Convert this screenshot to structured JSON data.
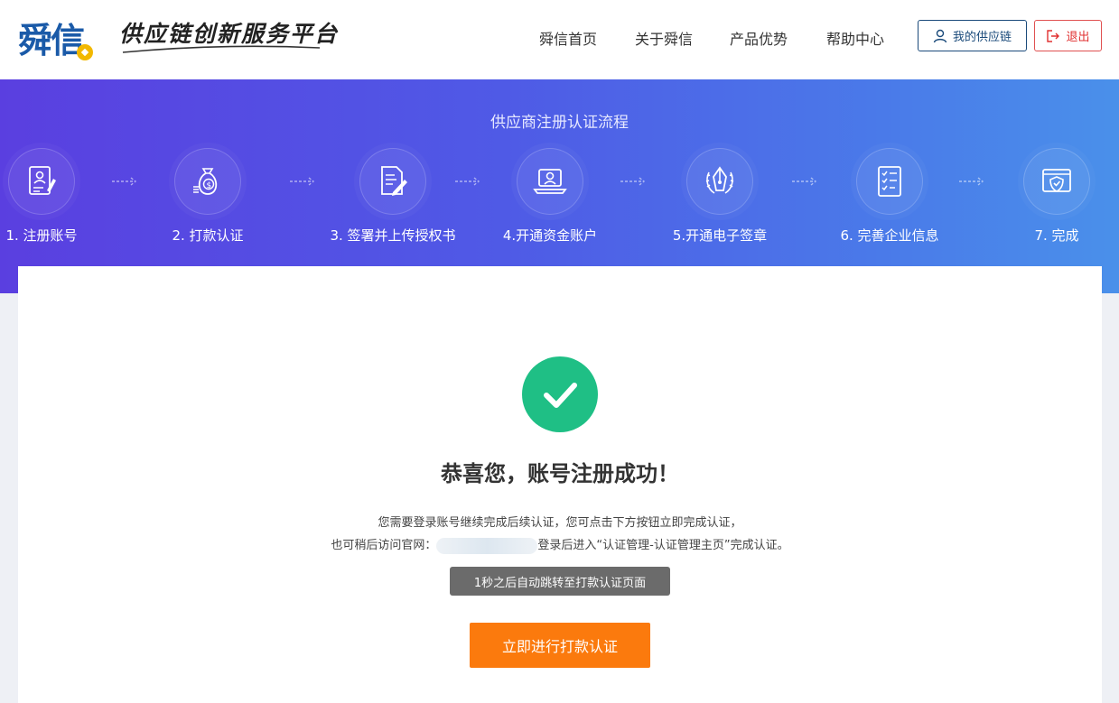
{
  "header": {
    "logo_text": "舜信",
    "slogan": "供应链创新服务平台",
    "nav": [
      {
        "label": "舜信首页"
      },
      {
        "label": "关于舜信"
      },
      {
        "label": "产品优势"
      },
      {
        "label": "帮助中心"
      }
    ],
    "my_chain_label": "我的供应链",
    "exit_label": "退出"
  },
  "banner": {
    "title": "供应商注册认证流程",
    "steps": [
      {
        "label": "1. 注册账号",
        "icon": "register-document-icon"
      },
      {
        "label": "2. 打款认证",
        "icon": "money-bag-icon"
      },
      {
        "label": "3. 签署并上传授权书",
        "icon": "sign-document-icon"
      },
      {
        "label": "4.开通资金账户",
        "icon": "laptop-account-icon"
      },
      {
        "label": "5.开通电子签章",
        "icon": "pen-seal-icon"
      },
      {
        "label": "6. 完善企业信息",
        "icon": "checklist-icon"
      },
      {
        "label": "7. 完成",
        "icon": "shield-check-icon"
      }
    ]
  },
  "main": {
    "title": "恭喜您，账号注册成功！",
    "line1": "您需要登录账号继续完成后续认证，您可点击下方按钮立即完成认证，",
    "line2_prefix": "也可稍后访问官网：",
    "line2_suffix": "登录后进入“认证管理-认证管理主页”完成认证。",
    "countdown": "1秒之后自动跳转至打款认证页面",
    "button_label": "立即进行打款认证"
  },
  "colors": {
    "brand_blue": "#1a5aa8",
    "success_green": "#1fbf85",
    "primary_orange": "#fb7a0d",
    "exit_red": "#e03030"
  }
}
